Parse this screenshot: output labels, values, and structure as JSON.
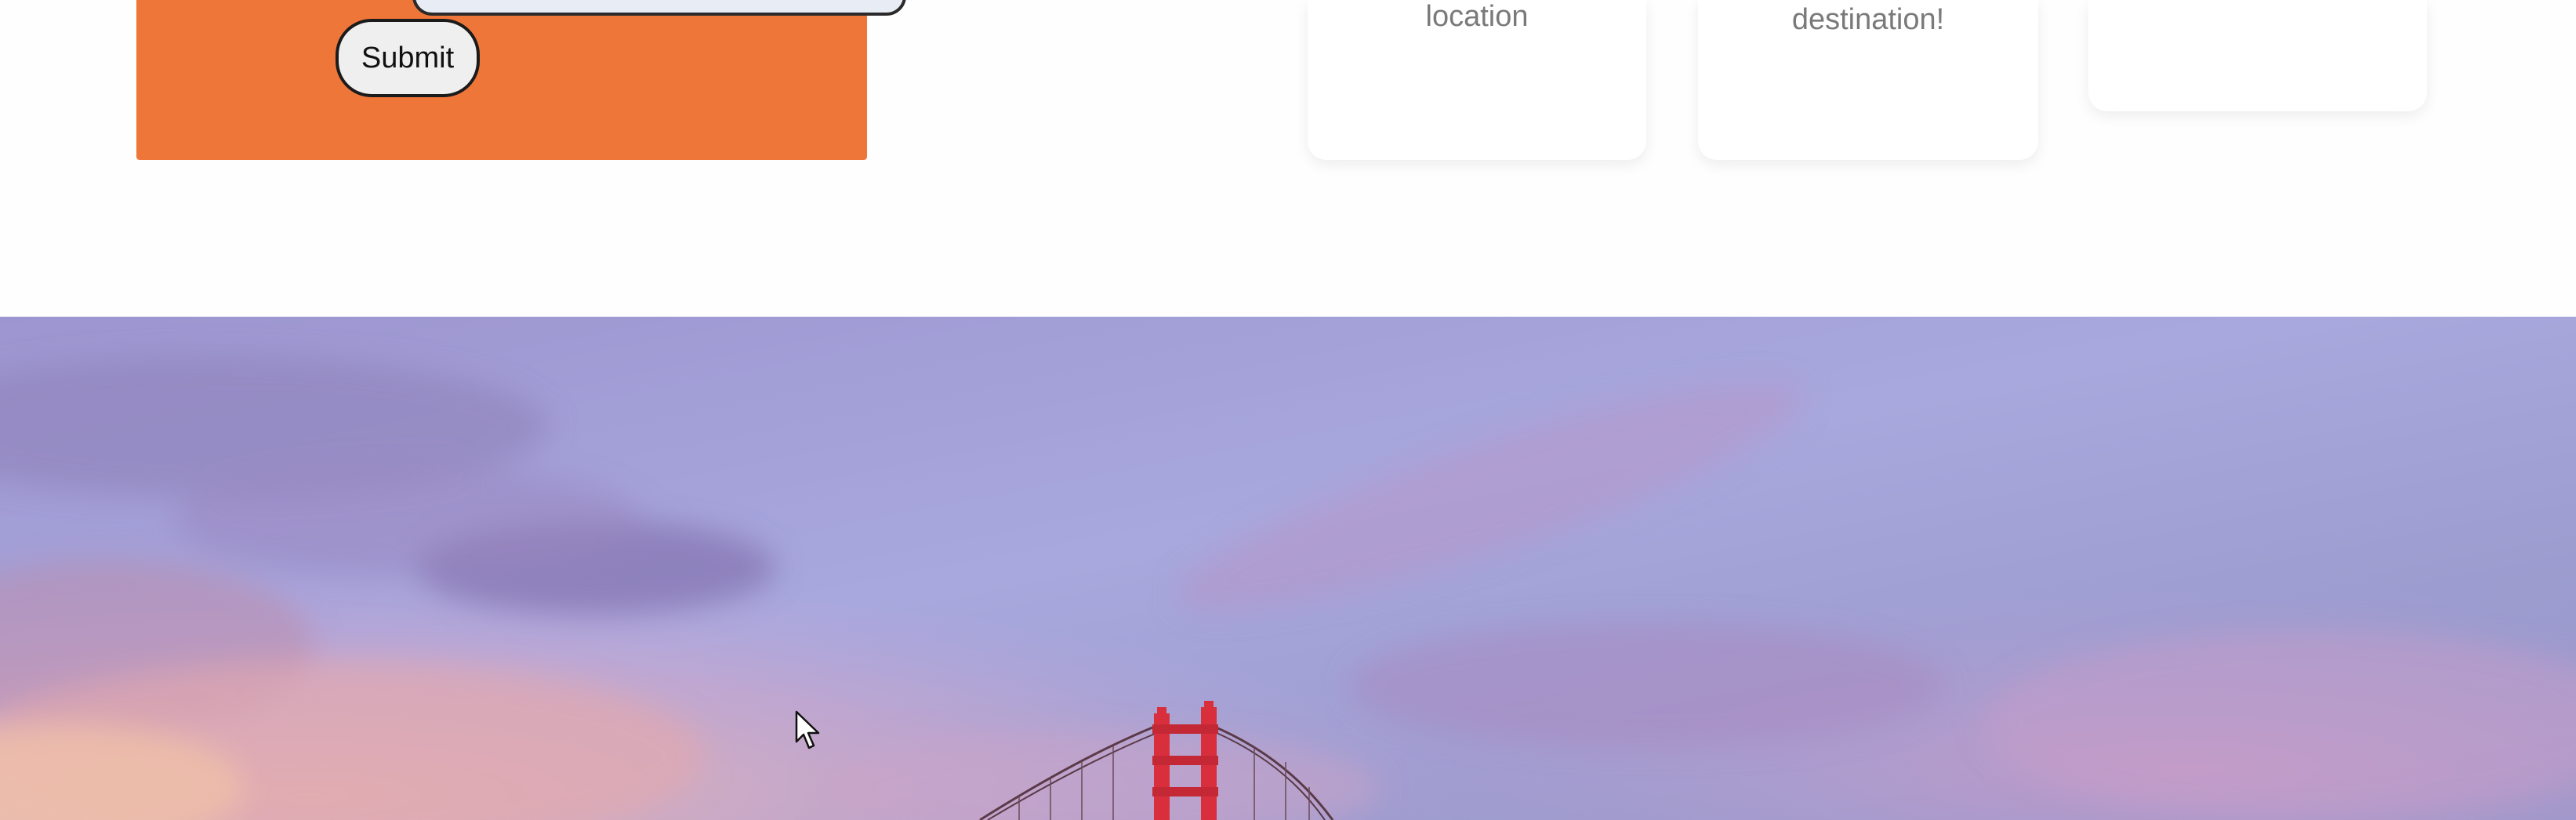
{
  "form": {
    "submit_label": "Submit",
    "accent_color": "#ef7639"
  },
  "cards": [
    {
      "text": "location"
    },
    {
      "text": "destination!"
    },
    {
      "text": ""
    }
  ],
  "hero": {
    "subject": "golden-gate-bridge-tower",
    "sky_colors": [
      "#a69cd6",
      "#c3b0d8",
      "#d6b3c8"
    ],
    "tower_color": "#d92f3d"
  },
  "cursor": {
    "icon": "arrow-pointer-icon"
  }
}
